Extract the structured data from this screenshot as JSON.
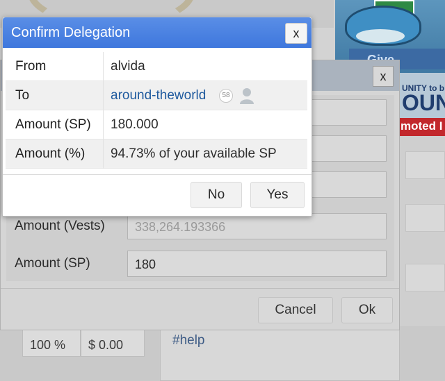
{
  "confirm": {
    "title": "Confirm Delegation",
    "close_label": "x",
    "rows": [
      {
        "key": "From",
        "value": "alvida"
      },
      {
        "key": "To",
        "value": "around-theworld",
        "reputation": "58"
      },
      {
        "key": "Amount (SP)",
        "value": "180.000"
      },
      {
        "key": "Amount (%)",
        "value": "94.73% of your available SP"
      }
    ],
    "no_label": "No",
    "yes_label": "Yes"
  },
  "delegate_dialog": {
    "close_label": "x",
    "vests_label": "Amount (Vests)",
    "vests_value": "338,264.193366",
    "sp_label": "Amount (SP)",
    "sp_value": "180",
    "cancel_label": "Cancel",
    "ok_label": "Ok"
  },
  "background": {
    "banner_give": "Give",
    "banner_unity": "UNITY to b",
    "banner_big": "OUN",
    "banner_promoted": "moted I",
    "percent": "100 %",
    "amount": "$ 0.00",
    "help_tag": "#help"
  },
  "colors": {
    "title_bar": "#4a82e0",
    "link": "#1f5a9e"
  }
}
